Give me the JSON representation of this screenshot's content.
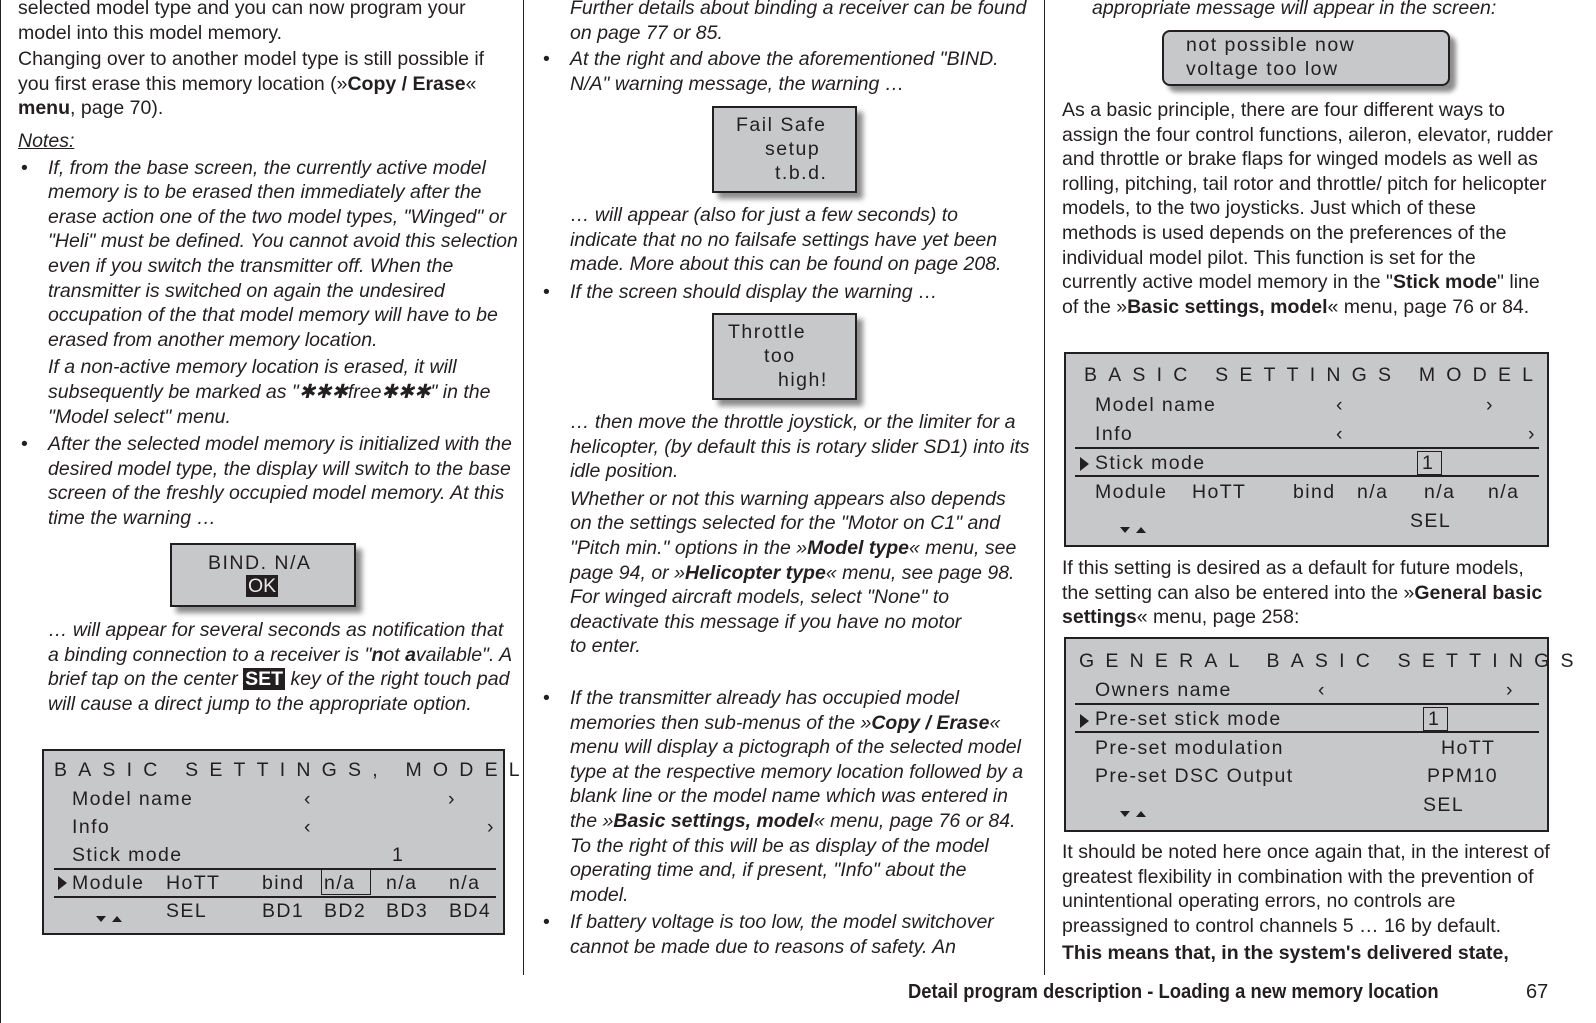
{
  "col1": {
    "p1": "selected model type and you can now program your model into this model memory.",
    "p2_pre": "Changing over to another model type is still possible if you first erase this memory location (»",
    "p2_bold1": "Copy / Erase",
    "p2_mid": "« ",
    "p2_bold2": "menu",
    "p2_post": ", page 70).",
    "notes_heading": "Notes:",
    "bullet1": "If, from the base screen, the currently active model memory is to be erased then immediately after the erase action one of the two model types, \"Winged\" or \"Heli\" must be defined. You cannot avoid this selection even if you switch the transmitter off. When the transmitter is switched on again the undesired occupation of the that model memory will have to be erased from another memory location.",
    "bullet1_cont": "If a non-active memory location is erased, it will subsequently be marked as \"✱✱✱free✱✱✱\" in the \"Model select\" menu.",
    "bullet2": "After the selected model memory is initialized with the desired model type, the display will switch to the base screen of the freshly occupied model memory. At this time the warning …",
    "bind_popup": {
      "line1": "BIND. N/A",
      "ok_label": "OK"
    },
    "after_bind_pre": "… will appear for several seconds as notification that a binding connection to a receiver is \"",
    "after_bind_n": "n",
    "after_bind_mid1": "ot ",
    "after_bind_a": "a",
    "after_bind_mid2": "vailable\". A brief tap on the center ",
    "set_key": "SET",
    "after_bind_post": " key of the right touch pad will cause a direct jump to the appropriate option.",
    "screen": {
      "title": "BASIC SETTINGS, MODEL",
      "rows": [
        {
          "label": "Model name",
          "left": "‹",
          "right": "›"
        },
        {
          "label": "Info",
          "left": "‹",
          "right": "›"
        },
        {
          "label": "Stick mode",
          "value": "1"
        },
        {
          "label": "Module",
          "module": "HoTT",
          "bind": "bind",
          "bd2": "n/a",
          "bd3": "n/a",
          "bd4": "n/a"
        }
      ],
      "footer": {
        "sel": "SEL",
        "bd1": "BD1",
        "bd2": "BD2",
        "bd3": "BD3",
        "bd4": "BD4"
      }
    }
  },
  "col2": {
    "p1": "Further details about binding a receiver can be found on page 77 or 85.",
    "bullet1": "At the right and above the aforementioned \"BIND. N/A\" warning message, the warning …",
    "failsafe_popup": {
      "line1": "Fail Safe",
      "line2": "setup",
      "line3": "t.b.d."
    },
    "after_failsafe": "… will appear (also for just a few seconds) to indicate that no no failsafe settings have yet been made. More about this can be found on page 208.",
    "bullet2": "If the screen should display the warning …",
    "throttle_popup": {
      "line1": "Throttle",
      "line2": "too",
      "line3": "high!"
    },
    "after_throttle": "… then move the throttle joystick, or the limiter for a helicopter, (by default this is rotary slider SD1) into its idle position.",
    "whether_pre": "Whether or not this warning appears also depends on the settings selected for the \"Motor on C1\" and \"Pitch min.\" options in the »",
    "whether_bold1": "Model type",
    "whether_mid": "« menu, see page 94, or »",
    "whether_bold2": "Helicopter type",
    "whether_post": "« menu, see page 98. For winged aircraft models, select \"None\" to deactivate this message if you have no motor",
    "to_enter": "to enter.",
    "bullet3_pre": "If the transmitter already has occupied model memories then sub-menus of the »",
    "bullet3_bold1": "Copy / Erase",
    "bullet3_mid": "« menu will display a pictograph of the selected model type at the respective memory location followed by a blank line or the model name which was entered in the »",
    "bullet3_bold2": "Basic settings, model",
    "bullet3_post": "« menu, page 76 or 84. To the right of this will be as display of the model operating time and, if present, \"Info\" about the model.",
    "bullet4": "If battery voltage is too low, the model switchover cannot be made due to reasons of safety. An"
  },
  "col3": {
    "p1": "appropriate message will appear in the screen:",
    "voltage_popup": {
      "line1": "not possible now",
      "line2": "voltage too low"
    },
    "p2_pre": "As a basic principle, there are four different ways to assign the four control functions, aileron, elevator, rudder and throttle or brake flaps for winged models as well as rolling, pitching, tail rotor and throttle/ pitch for helicopter models, to the two joysticks. Just which of these methods is used depends on the preferences of the individual model pilot. This function is set for the currently active model memory in the \"",
    "p2_bold1": "Stick mode",
    "p2_mid": "\" line of the »",
    "p2_bold2": "Basic settings, model",
    "p2_post": "« menu, page 76 or 84.",
    "screen1": {
      "title": "BASIC SETTINGS MODEL",
      "rows": [
        {
          "label": "Model name",
          "left": "‹",
          "right": "›"
        },
        {
          "label": "Info",
          "left": "‹",
          "right": "›"
        },
        {
          "label": "Stick mode",
          "value": "1"
        },
        {
          "label": "Module",
          "module": "HoTT",
          "bind": "bind",
          "c1": "n/a",
          "c2": "n/a",
          "c3": "n/a"
        }
      ],
      "footer": {
        "sel": "SEL"
      }
    },
    "p3_pre": "If this setting is desired as a default for future models, the setting can also be entered into the »",
    "p3_bold": "General basic settings",
    "p3_post": "« menu, page 258:",
    "screen2": {
      "title": "GENERAL BASIC SETTINGS",
      "rows": [
        {
          "label": "Owners name",
          "left": "‹",
          "right": "›"
        },
        {
          "label": "Pre-set stick mode",
          "value": "1"
        },
        {
          "label": "Pre-set modulation",
          "value": "HoTT"
        },
        {
          "label": "Pre-set DSC Output",
          "value": "PPM10"
        }
      ],
      "footer": {
        "sel": "SEL"
      }
    },
    "p4": "It should be noted here once again that, in the interest of greatest flexibility in combination with the prevention of unintentional operating errors, no controls are preassigned to control channels 5 … 16 by default.",
    "p5": "This means that, in the system's delivered state,"
  },
  "footer": {
    "title": "Detail program description - Loading a new memory location",
    "page_number": "67"
  }
}
